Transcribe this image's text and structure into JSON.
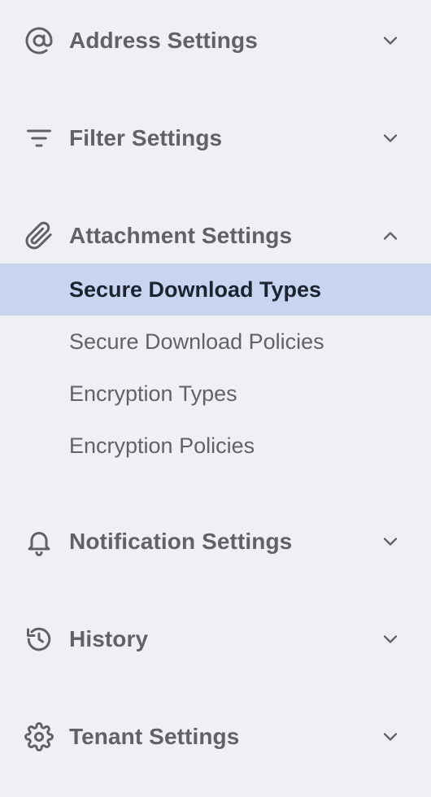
{
  "sections": [
    {
      "label": "Address Settings",
      "icon": "at-icon",
      "expanded": false
    },
    {
      "label": "Filter Settings",
      "icon": "filter-icon",
      "expanded": false
    },
    {
      "label": "Attachment Settings",
      "icon": "paperclip-icon",
      "expanded": true,
      "items": [
        {
          "label": "Secure Download Types",
          "active": true
        },
        {
          "label": "Secure Download Policies",
          "active": false
        },
        {
          "label": "Encryption Types",
          "active": false
        },
        {
          "label": "Encryption Policies",
          "active": false
        }
      ]
    },
    {
      "label": "Notification Settings",
      "icon": "bell-icon",
      "expanded": false
    },
    {
      "label": "History",
      "icon": "history-icon",
      "expanded": false
    },
    {
      "label": "Tenant Settings",
      "icon": "gear-icon",
      "expanded": false
    }
  ],
  "colors": {
    "background": "#eff0f4",
    "active_background": "#c9d5f0",
    "text": "#5f6267",
    "active_text": "#1c2432"
  }
}
